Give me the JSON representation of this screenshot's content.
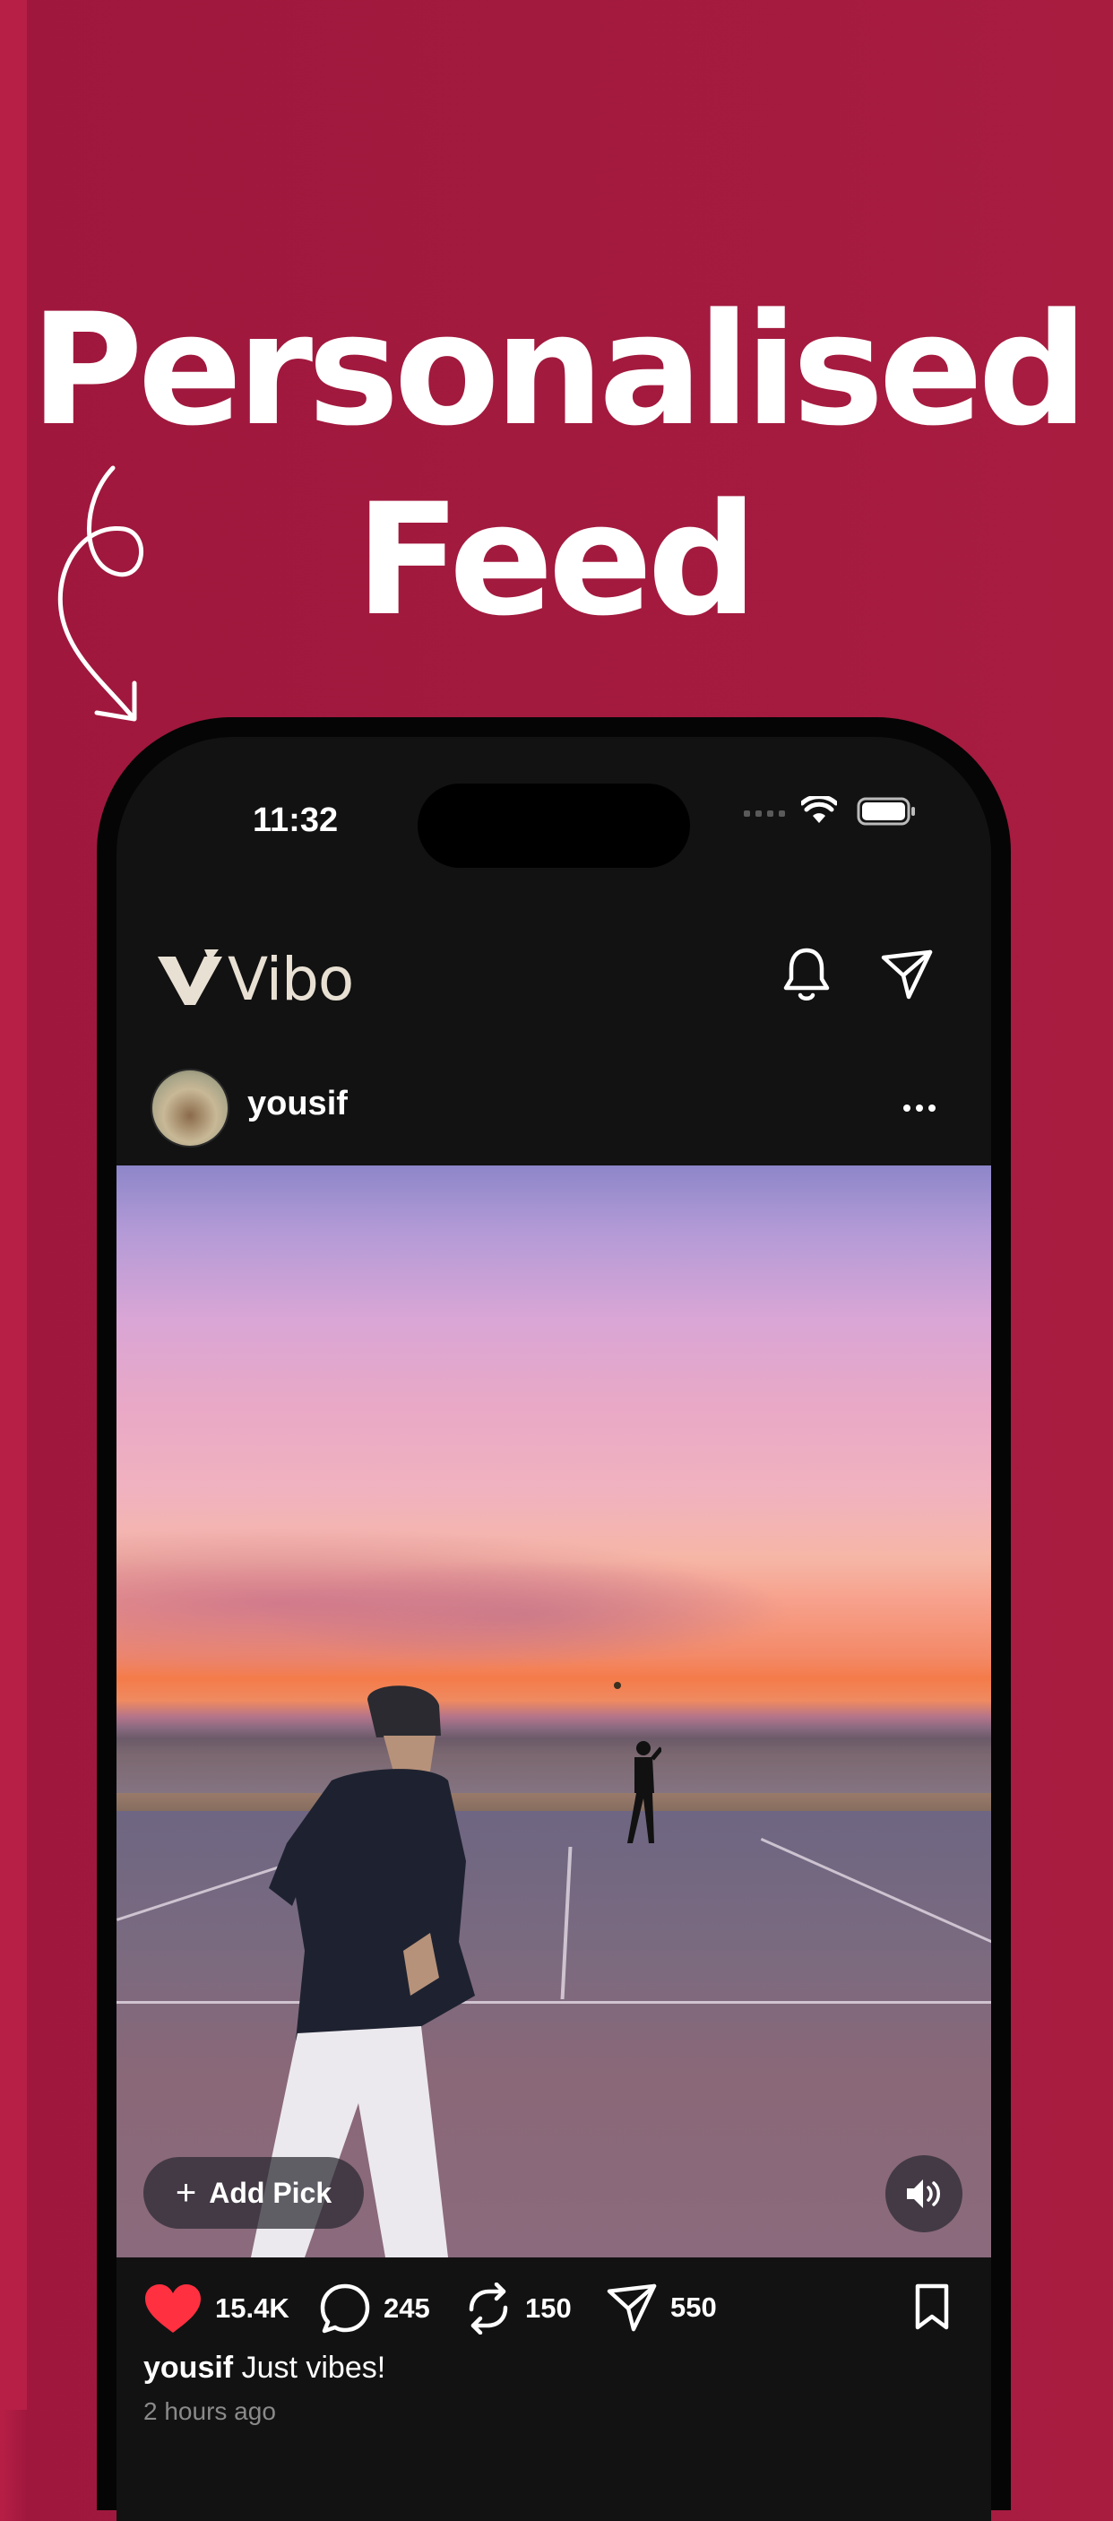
{
  "headline": {
    "line1": "Personalised",
    "line2": "Feed"
  },
  "status_bar": {
    "time": "11:32"
  },
  "app": {
    "name": "Vibo"
  },
  "post": {
    "username": "yousif",
    "add_pick_label": "Add Pick",
    "likes": "15.4K",
    "comments": "245",
    "reposts": "150",
    "shares": "550",
    "caption_user": "yousif",
    "caption_text": "Just vibes!",
    "timestamp": "2 hours ago"
  },
  "colors": {
    "background": "#a21a3e",
    "like": "#ff3040",
    "screen": "#121212"
  },
  "icons": [
    "vibo-logo-icon",
    "bell-icon",
    "send-icon",
    "more-icon",
    "plus-icon",
    "speaker-icon",
    "heart-icon",
    "comment-icon",
    "repost-icon",
    "share-icon",
    "bookmark-icon",
    "wifi-icon",
    "battery-icon",
    "curly-arrow-icon"
  ]
}
